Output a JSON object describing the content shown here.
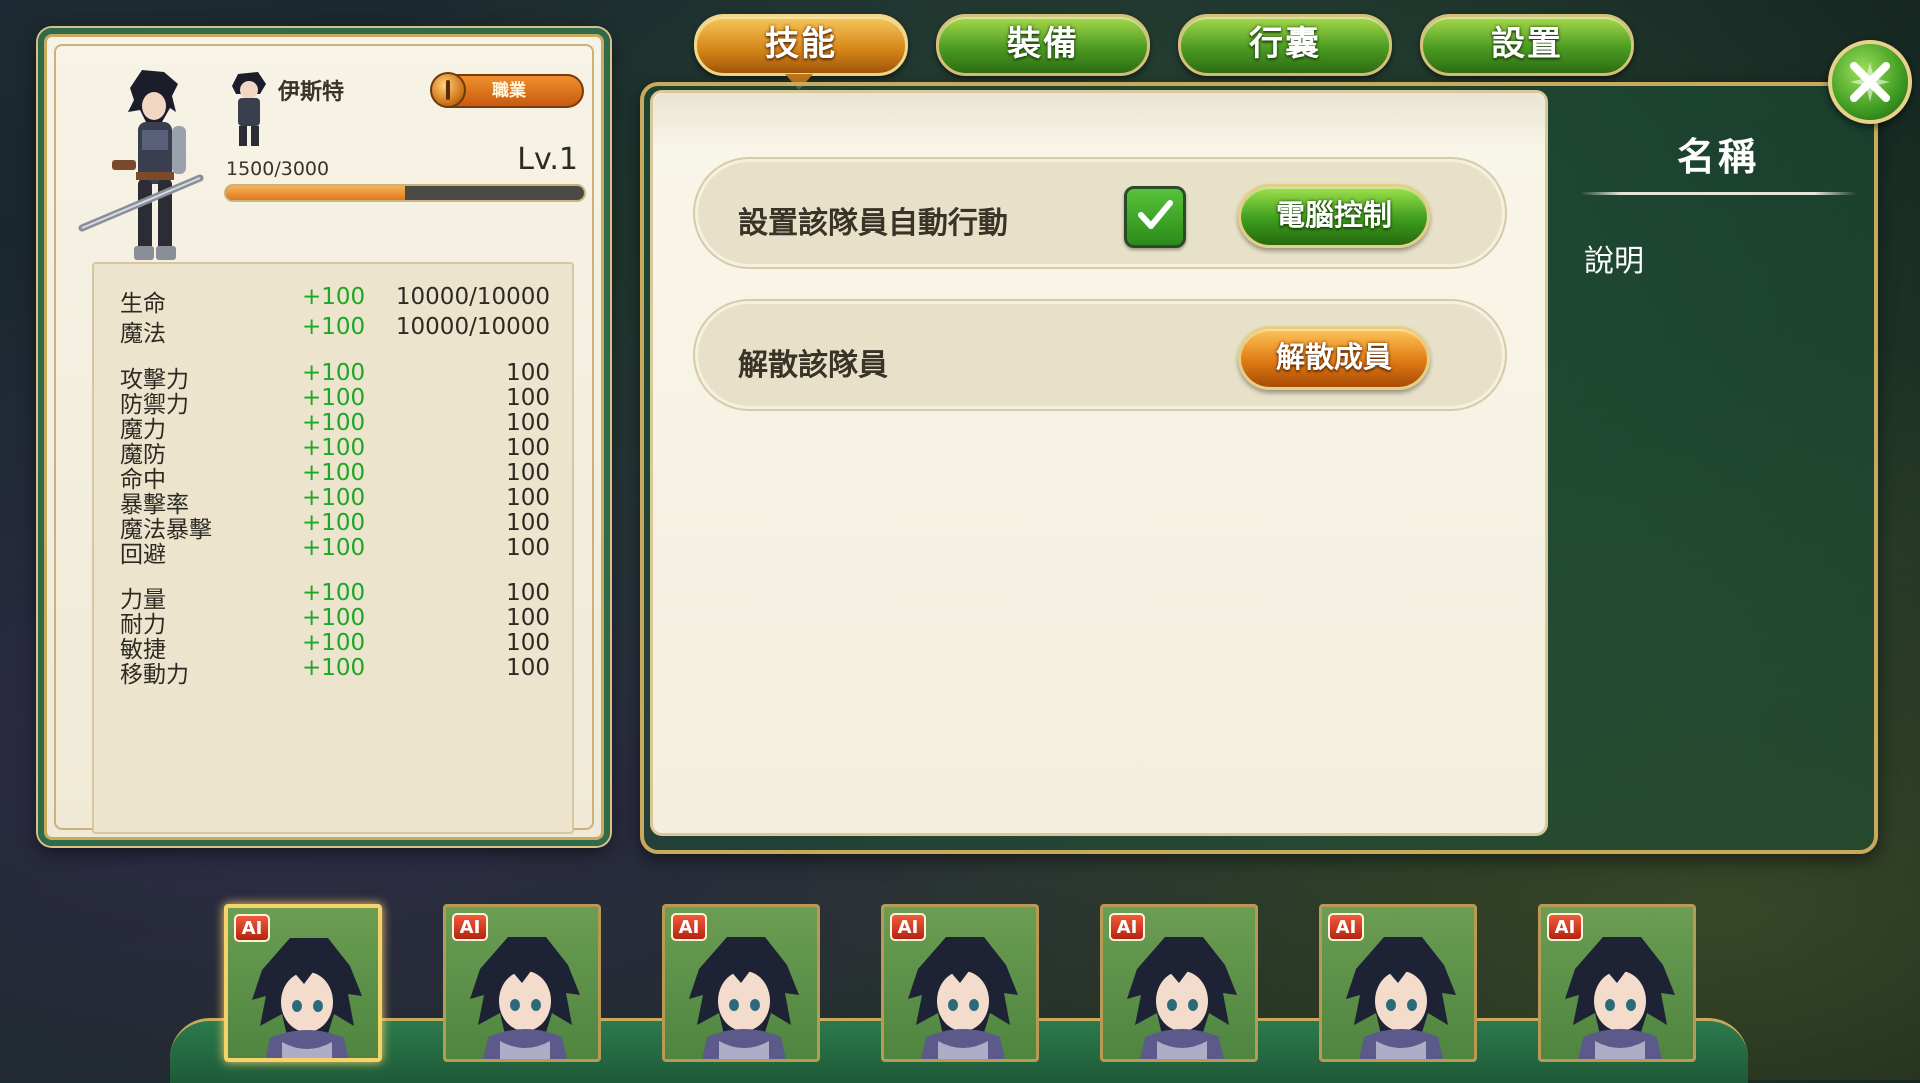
{
  "tabs": [
    {
      "label": "技能",
      "active": true
    },
    {
      "label": "裝備",
      "active": false
    },
    {
      "label": "行囊",
      "active": false
    },
    {
      "label": "設置",
      "active": false
    }
  ],
  "character": {
    "name": "伊斯特",
    "job_label": "職業",
    "exp_text": "1500/3000",
    "exp_fraction": 0.5,
    "level_text": "Lv.1"
  },
  "stats": [
    {
      "label": "生命",
      "bonus": "+100",
      "value": "10000/10000"
    },
    {
      "label": "魔法",
      "bonus": "+100",
      "value": "10000/10000"
    },
    {
      "label": "攻擊力",
      "bonus": "+100",
      "value": "100"
    },
    {
      "label": "防禦力",
      "bonus": "+100",
      "value": "100"
    },
    {
      "label": "魔力",
      "bonus": "+100",
      "value": "100"
    },
    {
      "label": "魔防",
      "bonus": "+100",
      "value": "100"
    },
    {
      "label": "命中",
      "bonus": "+100",
      "value": "100"
    },
    {
      "label": "暴擊率",
      "bonus": "+100",
      "value": "100"
    },
    {
      "label": "魔法暴擊",
      "bonus": "+100",
      "value": "100"
    },
    {
      "label": "回避",
      "bonus": "+100",
      "value": "100"
    },
    {
      "label": "力量",
      "bonus": "+100",
      "value": "100"
    },
    {
      "label": "耐力",
      "bonus": "+100",
      "value": "100"
    },
    {
      "label": "敏捷",
      "bonus": "+100",
      "value": "100"
    },
    {
      "label": "移動力",
      "bonus": "+100",
      "value": "100"
    }
  ],
  "settings": {
    "auto_action_label": "設置該隊員自動行動",
    "auto_action_checked": true,
    "ai_control_button": "電腦控制",
    "dismiss_label": "解散該隊員",
    "dismiss_button": "解散成員"
  },
  "info": {
    "title": "名稱",
    "description": "說明"
  },
  "party": {
    "ai_badge": "AI",
    "slot_count": 7,
    "selected_index": 0
  },
  "colors": {
    "bonus_green": "#1fa52a",
    "tab_active": "#d88a1c",
    "tab_inactive": "#4c9b22",
    "panel_cream": "#f9f6ea",
    "frame_gold": "#c9a95c"
  }
}
